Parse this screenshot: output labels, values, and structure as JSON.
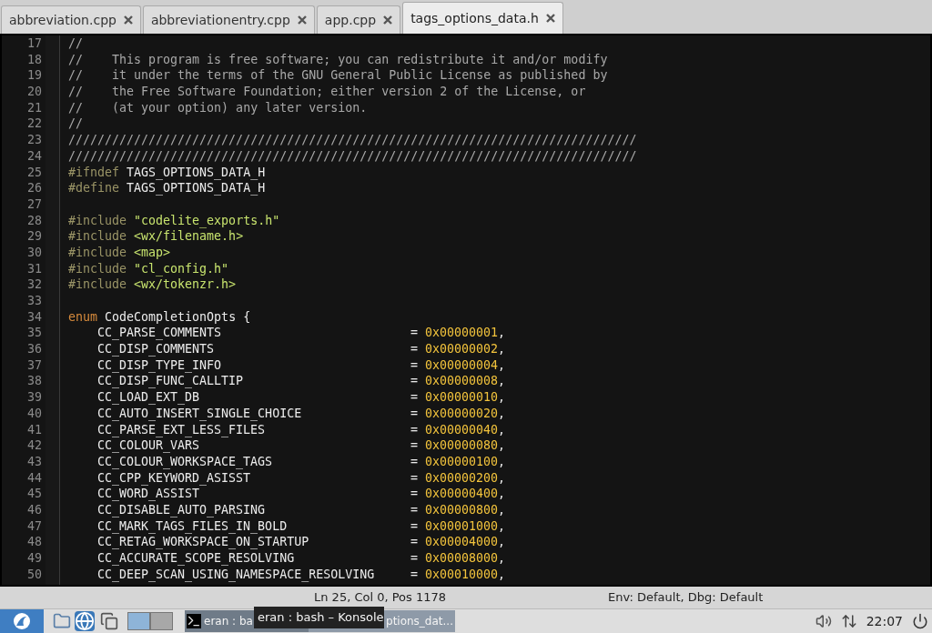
{
  "tabs": [
    {
      "label": "abbreviation.cpp",
      "selected": false
    },
    {
      "label": "abbreviationentry.cpp",
      "selected": false
    },
    {
      "label": "app.cpp",
      "selected": false
    },
    {
      "label": "tags_options_data.h",
      "selected": true
    }
  ],
  "editor": {
    "lines": [
      {
        "kind": "code",
        "n": "17",
        "segs": [
          {
            "kind": "comment",
            "text": "//"
          }
        ]
      },
      {
        "kind": "code",
        "n": "18",
        "segs": [
          {
            "kind": "comment",
            "text": "//    This program is free software; you can redistribute it and/or modify"
          }
        ]
      },
      {
        "kind": "code",
        "n": "19",
        "segs": [
          {
            "kind": "comment",
            "text": "//    it under the terms of the GNU General Public License as published by"
          }
        ]
      },
      {
        "kind": "code",
        "n": "20",
        "segs": [
          {
            "kind": "comment",
            "text": "//    the Free Software Foundation; either version 2 of the License, or"
          }
        ]
      },
      {
        "kind": "code",
        "n": "21",
        "segs": [
          {
            "kind": "comment",
            "text": "//    (at your option) any later version."
          }
        ]
      },
      {
        "kind": "code",
        "n": "22",
        "segs": [
          {
            "kind": "comment",
            "text": "//"
          }
        ]
      },
      {
        "kind": "code",
        "n": "23",
        "segs": [
          {
            "kind": "comment",
            "text": "//////////////////////////////////////////////////////////////////////////////"
          }
        ]
      },
      {
        "kind": "code",
        "n": "24",
        "segs": [
          {
            "kind": "comment",
            "text": "//////////////////////////////////////////////////////////////////////////////"
          }
        ]
      },
      {
        "kind": "code",
        "n": "25",
        "segs": [
          {
            "kind": "preproc",
            "text": "#ifndef"
          },
          {
            "kind": "plain",
            "text": " TAGS_OPTIONS_DATA_H"
          }
        ]
      },
      {
        "kind": "code",
        "n": "26",
        "segs": [
          {
            "kind": "preproc",
            "text": "#define"
          },
          {
            "kind": "plain",
            "text": " TAGS_OPTIONS_DATA_H"
          }
        ]
      },
      {
        "kind": "code",
        "n": "27"
      },
      {
        "kind": "code",
        "n": "28",
        "segs": [
          {
            "kind": "preproc",
            "text": "#include"
          },
          {
            "kind": "string",
            "text": " \"codelite_exports.h\""
          }
        ]
      },
      {
        "kind": "code",
        "n": "29",
        "segs": [
          {
            "kind": "preproc",
            "text": "#include"
          },
          {
            "kind": "string",
            "text": " <wx/filename.h>"
          }
        ]
      },
      {
        "kind": "code",
        "n": "30",
        "segs": [
          {
            "kind": "preproc",
            "text": "#include"
          },
          {
            "kind": "string",
            "text": " <map>"
          }
        ]
      },
      {
        "kind": "code",
        "n": "31",
        "segs": [
          {
            "kind": "preproc",
            "text": "#include"
          },
          {
            "kind": "string",
            "text": " \"cl_config.h\""
          }
        ]
      },
      {
        "kind": "code",
        "n": "32",
        "segs": [
          {
            "kind": "preproc",
            "text": "#include"
          },
          {
            "kind": "string",
            "text": " <wx/tokenzr.h>"
          }
        ]
      },
      {
        "kind": "code",
        "n": "33"
      },
      {
        "kind": "code",
        "n": "34",
        "segs": [
          {
            "kind": "keyword",
            "text": "enum"
          },
          {
            "kind": "plain",
            "text": " CodeCompletionOpts {"
          }
        ]
      },
      {
        "kind": "enum_entry",
        "n": "35",
        "name": "CC_PARSE_COMMENTS",
        "op": "=",
        "value": "0x00000001",
        "comma": ","
      },
      {
        "kind": "enum_entry",
        "n": "36",
        "name": "CC_DISP_COMMENTS",
        "op": "=",
        "value": "0x00000002",
        "comma": ","
      },
      {
        "kind": "enum_entry",
        "n": "37",
        "name": "CC_DISP_TYPE_INFO",
        "op": "=",
        "value": "0x00000004",
        "comma": ","
      },
      {
        "kind": "enum_entry",
        "n": "38",
        "name": "CC_DISP_FUNC_CALLTIP",
        "op": "=",
        "value": "0x00000008",
        "comma": ","
      },
      {
        "kind": "enum_entry",
        "n": "39",
        "name": "CC_LOAD_EXT_DB",
        "op": "=",
        "value": "0x00000010",
        "comma": ","
      },
      {
        "kind": "enum_entry",
        "n": "40",
        "name": "CC_AUTO_INSERT_SINGLE_CHOICE",
        "op": "=",
        "value": "0x00000020",
        "comma": ","
      },
      {
        "kind": "enum_entry",
        "n": "41",
        "name": "CC_PARSE_EXT_LESS_FILES",
        "op": "=",
        "value": "0x00000040",
        "comma": ","
      },
      {
        "kind": "enum_entry",
        "n": "42",
        "name": "CC_COLOUR_VARS",
        "op": "=",
        "value": "0x00000080",
        "comma": ","
      },
      {
        "kind": "enum_entry",
        "n": "43",
        "name": "CC_COLOUR_WORKSPACE_TAGS",
        "op": "=",
        "value": "0x00000100",
        "comma": ","
      },
      {
        "kind": "enum_entry",
        "n": "44",
        "name": "CC_CPP_KEYWORD_ASISST",
        "op": "=",
        "value": "0x00000200",
        "comma": ","
      },
      {
        "kind": "enum_entry",
        "n": "45",
        "name": "CC_WORD_ASSIST",
        "op": "=",
        "value": "0x00000400",
        "comma": ","
      },
      {
        "kind": "enum_entry",
        "n": "46",
        "name": "CC_DISABLE_AUTO_PARSING",
        "op": "=",
        "value": "0x00000800",
        "comma": ","
      },
      {
        "kind": "enum_entry",
        "n": "47",
        "name": "CC_MARK_TAGS_FILES_IN_BOLD",
        "op": "=",
        "value": "0x00001000",
        "comma": ","
      },
      {
        "kind": "enum_entry",
        "n": "48",
        "name": "CC_RETAG_WORKSPACE_ON_STARTUP",
        "op": "=",
        "value": "0x00004000",
        "comma": ","
      },
      {
        "kind": "enum_entry",
        "n": "49",
        "name": "CC_ACCURATE_SCOPE_RESOLVING",
        "op": "=",
        "value": "0x00008000",
        "comma": ","
      },
      {
        "kind": "enum_entry",
        "n": "50",
        "name": "CC_DEEP_SCAN_USING_NAMESPACE_RESOLVING",
        "op": "=",
        "value": "0x00010000",
        "comma": ","
      }
    ]
  },
  "status_bar": {
    "position": "Ln 25, Col 0, Pos 1178",
    "env": "Env: Default, Dbg: Default"
  },
  "taskbar": {
    "tasks": [
      {
        "label": "eran : ba",
        "selected": false
      },
      {
        "label": "ptions_dat...",
        "selected": true
      }
    ],
    "tooltip": "eran : bash – Konsole",
    "clock": "22:07"
  }
}
